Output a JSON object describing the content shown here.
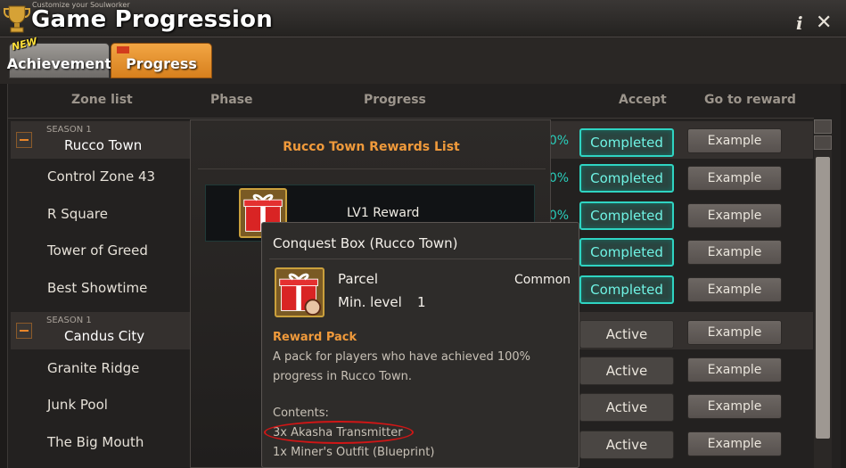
{
  "window": {
    "subtitle": "Customize your Soulworker",
    "title": "Game Progression",
    "info_glyph": "i",
    "close_glyph": "✕"
  },
  "tabs": [
    {
      "label": "Achievement",
      "badge": "NEW",
      "selected": false
    },
    {
      "label": "Progress",
      "selected": true
    }
  ],
  "columns": {
    "zone_list": "Zone list",
    "phase": "Phase",
    "progress": "Progress",
    "accept": "Accept",
    "go_to_reward": "Go to reward"
  },
  "rows": [
    {
      "kind": "season",
      "season": "SEASON 1",
      "zone": "Rucco Town",
      "progress": "100%",
      "accept": "Completed",
      "reward": "Example"
    },
    {
      "kind": "zone",
      "zone": "Control Zone 43",
      "progress": "100%",
      "accept": "Completed",
      "reward": "Example"
    },
    {
      "kind": "zone",
      "zone": "R Square",
      "progress": "100%",
      "accept": "Completed",
      "reward": "Example"
    },
    {
      "kind": "zone",
      "zone": "Tower of Greed",
      "progress": "",
      "accept": "Completed",
      "reward": "Example"
    },
    {
      "kind": "zone",
      "zone": "Best Showtime",
      "progress": "",
      "accept": "Completed",
      "reward": "Example"
    },
    {
      "kind": "season",
      "season": "SEASON 1",
      "zone": "Candus City",
      "progress": "",
      "accept": "Active",
      "reward": "Example"
    },
    {
      "kind": "zone",
      "zone": "Granite Ridge",
      "progress": "",
      "accept": "Active",
      "reward": "Example"
    },
    {
      "kind": "zone",
      "zone": "Junk Pool",
      "progress": "",
      "accept": "Active",
      "reward": "Example"
    },
    {
      "kind": "zone",
      "zone": "The Big Mouth",
      "progress": "",
      "accept": "Active",
      "reward": "Example"
    }
  ],
  "rewards_list": {
    "title": "Rucco Town Rewards List",
    "entries": [
      {
        "label": "LV1 Reward",
        "icon": "gift-box-icon"
      }
    ]
  },
  "tooltip": {
    "title": "Conquest Box (Rucco Town)",
    "icon": "gift-box-icon",
    "type": "Parcel",
    "rarity": "Common",
    "min_level_label": "Min. level",
    "min_level_value": "1",
    "section": "Reward Pack",
    "description": "A pack for players who have achieved 100% progress in Rucco Town.",
    "contents_label": "Contents:",
    "contents": [
      "3x Akasha Transmitter",
      "1x Miner's Outfit (Blueprint)"
    ]
  },
  "colors": {
    "completed_border": "#2fd4c2",
    "completed_text": "#6ff3e4",
    "accent_orange": "#f09a3b",
    "highlight_circle": "#d01616"
  }
}
